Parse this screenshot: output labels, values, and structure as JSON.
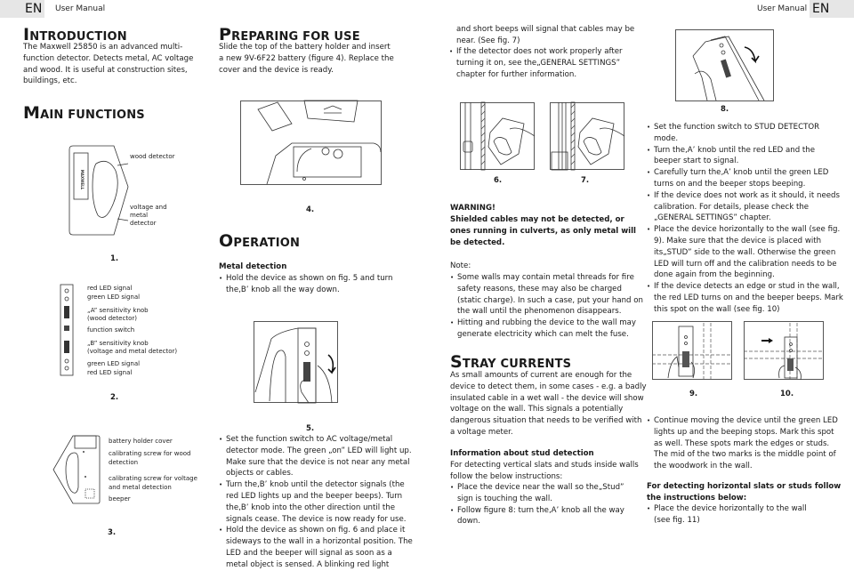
{
  "header": {
    "left": {
      "lang": "EN",
      "title": "User Manual"
    },
    "right": {
      "lang": "EN",
      "title": "User Manual"
    }
  },
  "introduction": {
    "title_cap": "I",
    "title_rest": "NTRODUCTION",
    "text": "The Maxwell 25850 is an advanced multi-function detector. Detects metal, AC voltage and wood. It is useful at construction sites, buildings, etc."
  },
  "main_functions": {
    "title_cap": "M",
    "title_rest": "AIN FUNCTIONS",
    "fig1": {
      "number": "1.",
      "labels": [
        "wood detector",
        "voltage and metal detector"
      ],
      "brand": "MAXWELL"
    },
    "fig2": {
      "number": "2.",
      "labels": [
        "red LED signal",
        "green LED signal",
        "„A” sensitivity knob",
        "(wood detector)",
        "function switch",
        "„B” sensitivity knob",
        "(voltage and metal detector)",
        "green LED signal",
        "red LED signal"
      ]
    },
    "fig3": {
      "number": "3.",
      "labels": [
        "battery holder cover",
        "calibrating screw for wood",
        "detection",
        "calibrating screw for voltage",
        "and metal detection",
        "beeper"
      ]
    }
  },
  "preparing": {
    "title_cap": "P",
    "title_rest": "REPARING FOR USE",
    "text": "Slide the top of the battery holder and insert a new 9V-6F22 battery (figure 4). Replace the cover and the device is ready.",
    "fig4_number": "4."
  },
  "operation": {
    "title_cap": "O",
    "title_rest": "PERATION",
    "metal_heading": "Metal detection",
    "metal_bullets": [
      "Hold the device as shown on fig. 5 and turn the‚B’ knob all the way down."
    ],
    "fig5_number": "5.",
    "bullets": [
      "Set the function switch to AC voltage/metal detector mode. The green „on” LED will light up. Make sure that the device is not near any metal objects or cables.",
      "Turn the‚B’ knob until the detector signals (the red LED lights up and the beeper beeps). Turn the‚B’ knob into the other direction until the signals cease. The device is now ready for use.",
      "Hold the device as shown on fig. 6 and place it sideways to the wall in a horizontal position. The LED and the beeper will signal as soon as a metal object is sensed. A blinking red light"
    ]
  },
  "col3": {
    "continuation": "and short beeps will signal that cables may be near.  (See fig. 7)",
    "bullets": [
      "If the detector does not work properly after turning it on, see the„GENERAL SETTINGS” chapter for further information."
    ],
    "fig6_number": "6.",
    "fig7_number": "7.",
    "warning_title": "WARNING!",
    "warning_text": "Shielded cables may not be detected, or ones running in culverts, as only metal will be detected.",
    "note_label": "Note:",
    "note_bullets": [
      "Some walls may contain metal threads for fire safety reasons, these may also be charged (static charge). In such a case, put your hand on the wall until the phenomenon disappears.",
      "Hitting and rubbing the device to the wall may generate electricity which can melt the fuse."
    ],
    "stray_title_cap": "S",
    "stray_title_rest": "TRAY CURRENTS",
    "stray_text": "As small amounts of current are enough for the device to detect them, in some cases - e.g. a badly insulated cable in a wet wall - the device will show voltage on the wall. This signals a potentially dangerous situation that needs to be verified with a voltage meter.",
    "stud_heading": "Information about stud detection",
    "stud_text": "For detecting vertical slats and studs inside walls follow the below instructions:",
    "stud_bullets": [
      "Place the device near the wall so the„Stud” sign is touching the wall.",
      "Follow figure 8: turn the‚A’ knob all the way down."
    ]
  },
  "col4": {
    "fig8_number": "8.",
    "bullets": [
      "Set the function switch to STUD DETECTOR mode.",
      "Turn the‚A’ knob until the red LED and the beeper start to signal.",
      "Carefully turn the‚A’ knob until the green LED turns on and the beeper stops beeping.",
      "If the device does not work as it should, it needs calibration. For details, please check the „GENERAL SETTINGS” chapter.",
      "Place the device horizontally to the wall (see fig. 9). Make sure that the device is placed with its„STUD” side to the wall. Otherwise the green LED will turn off and the calibration needs to be done again from the beginning.",
      "If the device detects an edge or stud in the wall, the red LED turns on and the beeper beeps. Mark this spot on the wall (see fig. 10)"
    ],
    "fig9_number": "9.",
    "fig10_number": "10.",
    "bullets2": [
      "Continue moving the device until the green LED lights up and the beeping stops. Mark this spot as well. These spots mark the edges or studs. The mid of the two marks is the middle point of the woodwork in the wall."
    ],
    "horiz_heading": "For detecting horizontal slats or studs follow the instructions below:",
    "horiz_bullets": [
      "Place the device horizontally to the wall (see fig. 11)"
    ]
  }
}
